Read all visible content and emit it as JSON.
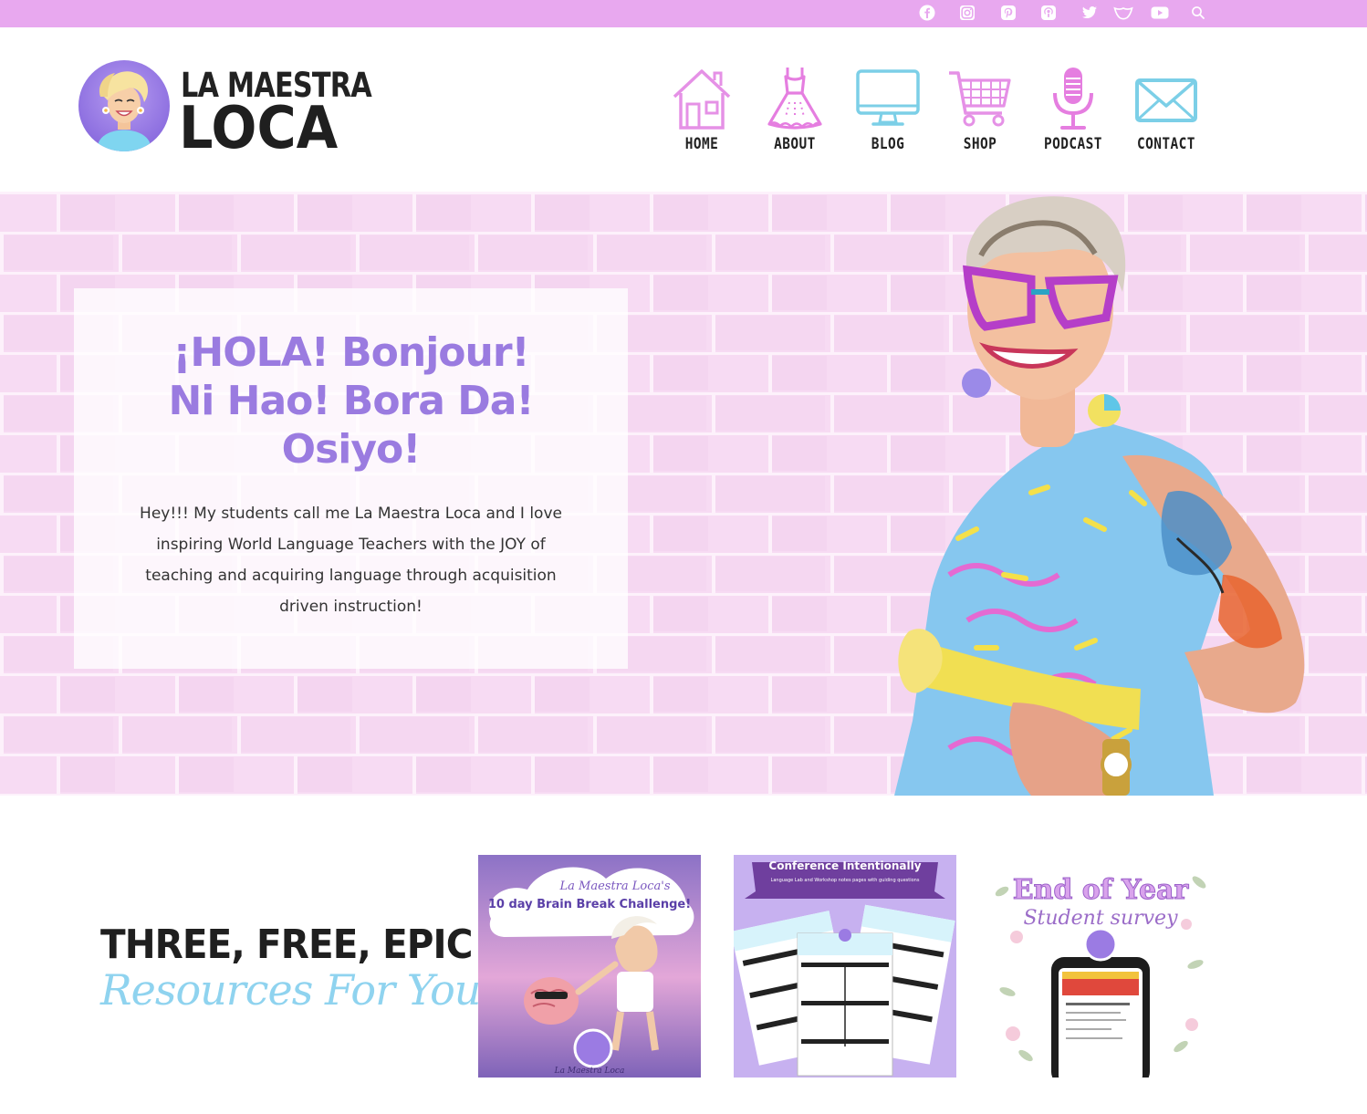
{
  "topbar": {
    "social": [
      "facebook-icon",
      "instagram-icon",
      "pinterest-icon",
      "podcast-icon",
      "twitter-icon",
      "tpt-icon",
      "youtube-icon",
      "search-icon"
    ]
  },
  "brand": {
    "line1": "LA MAESTRA",
    "line2": "LOCA"
  },
  "nav": {
    "items": [
      {
        "label": "HOME",
        "icon": "house-icon"
      },
      {
        "label": "ABOUT",
        "icon": "dress-icon"
      },
      {
        "label": "BLOG",
        "icon": "monitor-icon"
      },
      {
        "label": "SHOP",
        "icon": "cart-icon"
      },
      {
        "label": "PODCAST",
        "icon": "microphone-icon"
      },
      {
        "label": "CONTACT",
        "icon": "envelope-icon"
      }
    ]
  },
  "hero": {
    "title_line1": "¡HOLA! Bonjour!",
    "title_line2": "Ni Hao! Bora Da!",
    "title_line3": "Osiyo!",
    "text": "Hey!!! My students call me La Maestra Loca and I love inspiring World Language Teachers with the JOY of teaching and acquiring language through acquisition driven instruction!"
  },
  "resources": {
    "title": "THREE, FREE, EPIC",
    "subtitle": "Resources For You",
    "cards": [
      {
        "title_script": "La Maestra Loca's",
        "title": "10 day Brain Break Challenge!",
        "footer": "La Maestra Loca"
      },
      {
        "title": "Conference Intentionally",
        "subtitle": "Language Lab and Workshop notes pages with guiding questions"
      },
      {
        "title": "End of Year",
        "subtitle": "Student survey"
      }
    ]
  },
  "colors": {
    "topbar": "#e8a8ef",
    "hero_bg": "#f6d9f2",
    "accent_purple": "#9a7be0",
    "accent_pink": "#e57ee0",
    "accent_blue": "#8fd3ef"
  }
}
